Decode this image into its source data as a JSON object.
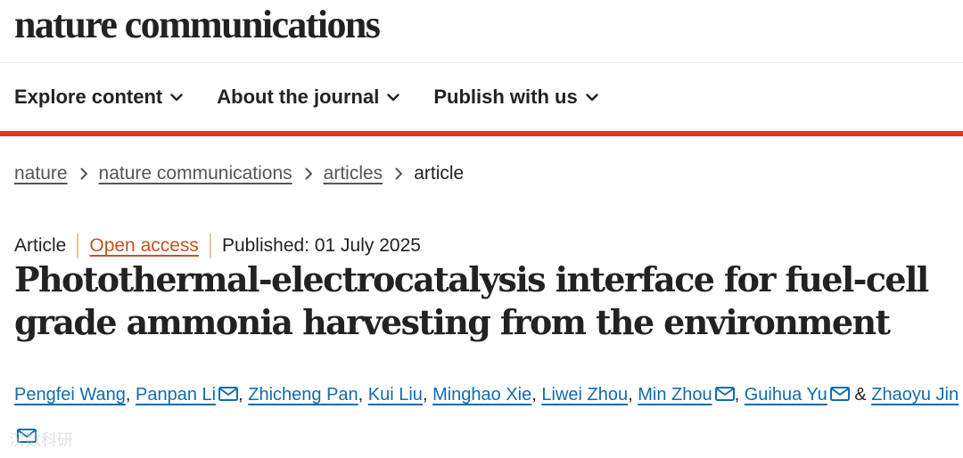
{
  "site": {
    "logo_text": "nature communications"
  },
  "nav": {
    "items": [
      {
        "label": "Explore content"
      },
      {
        "label": "About the journal"
      },
      {
        "label": "Publish with us"
      }
    ]
  },
  "breadcrumb": {
    "items": [
      "nature",
      "nature communications",
      "articles"
    ],
    "current": "article"
  },
  "article": {
    "type": "Article",
    "access": "Open access",
    "published": "Published: 01 July 2025",
    "title": "Photothermal-electrocatalysis interface for fuel-cell grade ammonia harvesting from the environment",
    "authors": [
      "Pengfei Wang",
      "Panpan Li",
      "Zhicheng Pan",
      "Kui Liu",
      "Minghao Xie",
      "Liwei Zhou",
      "Min Zhou",
      "Guihua Yu",
      "Zhaoyu Jin"
    ],
    "separator": ",",
    "conjunction": "&"
  },
  "watermark": "汉数科研",
  "colors": {
    "accent_red": "#e0362c",
    "link_blue": "#0f6db0",
    "open_access_orange": "#c05521"
  }
}
